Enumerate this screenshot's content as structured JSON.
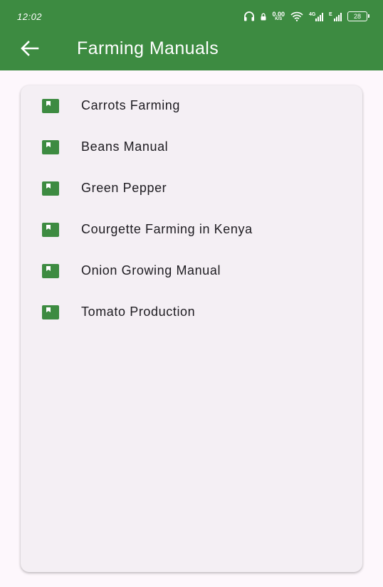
{
  "status_bar": {
    "time": "12:02",
    "net_speed_value": "0.00",
    "net_speed_unit": "K/S",
    "signal1_label": "4G",
    "signal2_label": "E",
    "battery": "28",
    "icons": [
      "headphones-icon",
      "net-speed-icon",
      "wifi-icon",
      "signal-4g-icon",
      "signal-e-icon",
      "battery-icon"
    ]
  },
  "appbar": {
    "title": "Farming Manuals",
    "back_icon": "arrow-back-icon",
    "color": "#3d8b41"
  },
  "manuals": {
    "icon": "book-icon",
    "icon_color": "#3d8b41",
    "items": [
      "Carrots Farming",
      "Beans Manual",
      "Green Pepper",
      "Courgette Farming in Kenya",
      "Onion Growing Manual",
      "Tomato Production"
    ]
  },
  "colors": {
    "page_background": "#fdf7fc",
    "card_background": "#f4eff4",
    "text": "#1d1b20"
  }
}
